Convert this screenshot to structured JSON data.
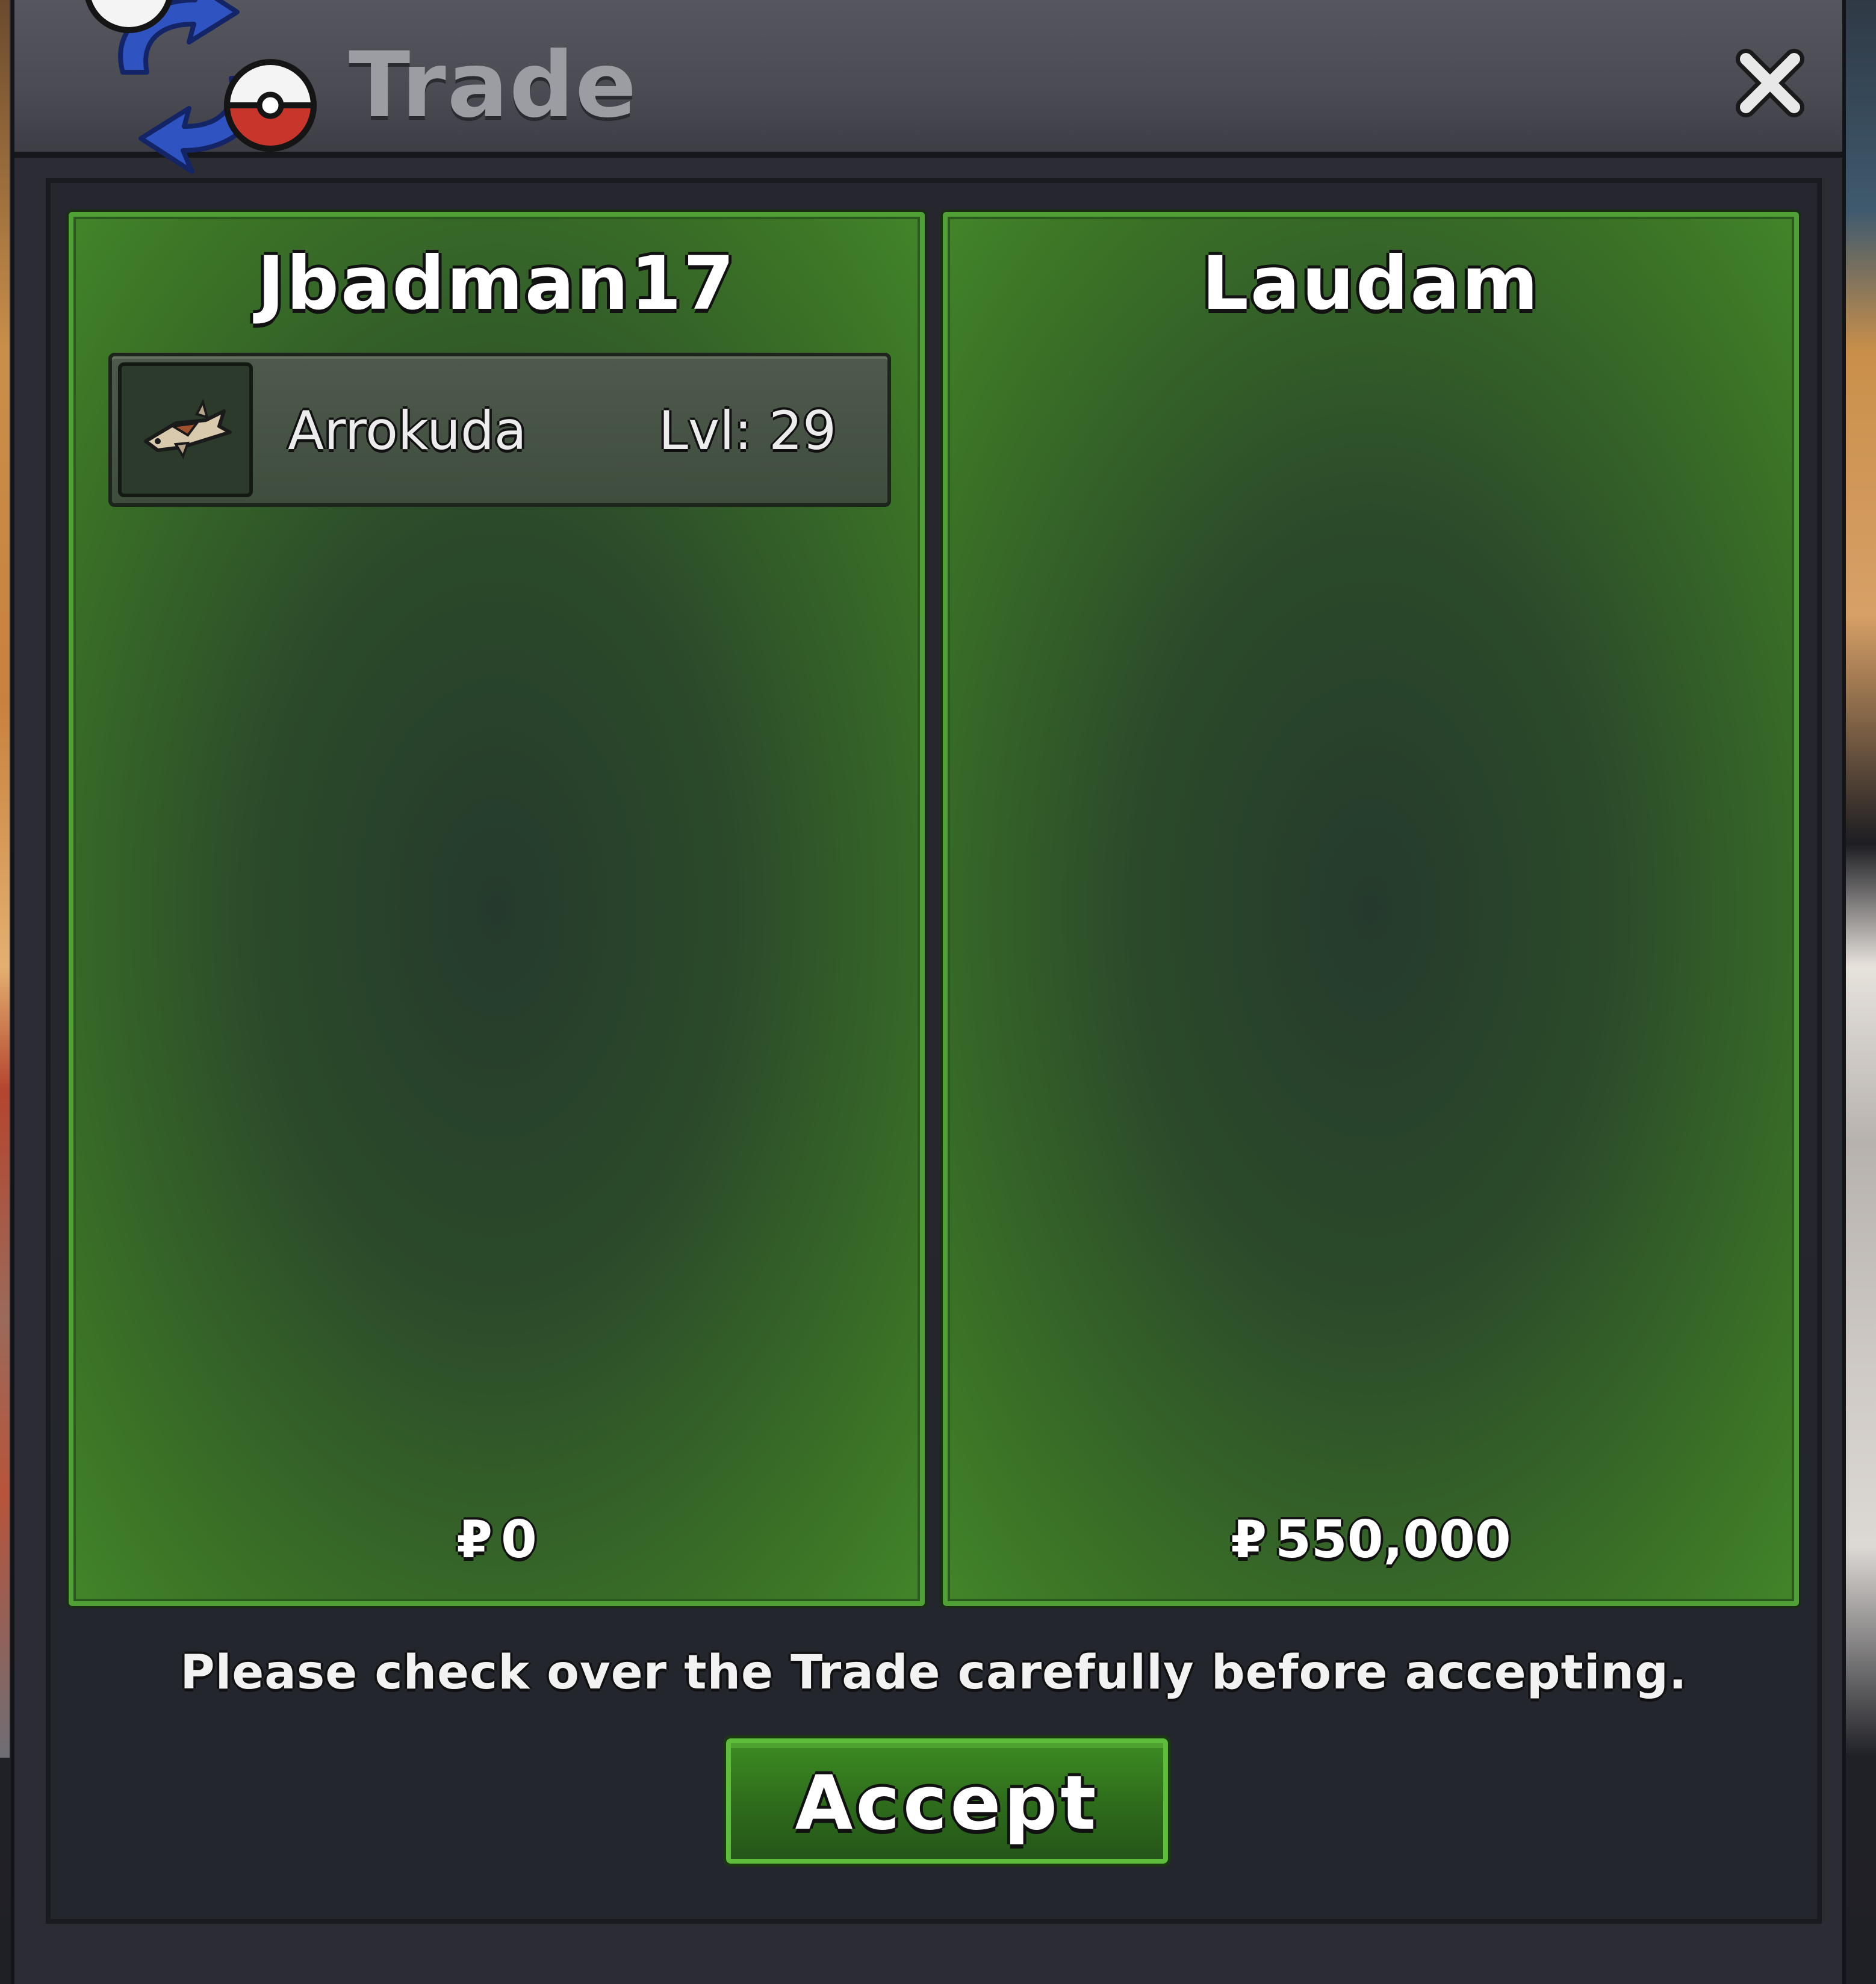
{
  "window": {
    "title": "Trade",
    "logo_icon": "trade-swap-pokeball-icon",
    "close_icon": "close-x-icon"
  },
  "offers": [
    {
      "player": "Jbadman17",
      "items": [
        {
          "name": "Arrokuda",
          "level": "Lvl: 29",
          "icon": "arrokuda-fish-icon"
        }
      ],
      "currency_symbol": "₽",
      "money": "0"
    },
    {
      "player": "Laudam",
      "items": [],
      "currency_symbol": "₽",
      "money": "550,000"
    }
  ],
  "notice": "Please check over the Trade carefully before accepting.",
  "accept_label": "Accept",
  "colors": {
    "panel_green": "#3c7626",
    "panel_border": "#4fa136",
    "button_green": "#2f6d1b",
    "title_gray": "#9c9da3",
    "pokeball_red": "#c8352b",
    "swap_blue": "#2f53c0"
  }
}
